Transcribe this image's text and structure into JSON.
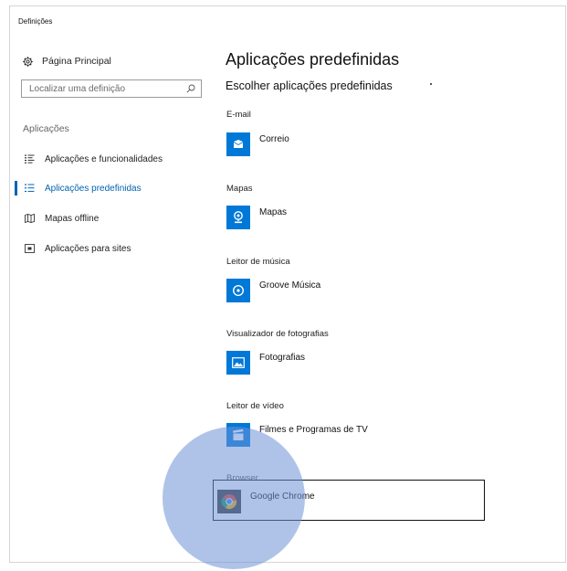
{
  "window": {
    "title": "Definições"
  },
  "sidebar": {
    "home_label": "Página Principal",
    "search_placeholder": "Localizar uma definição",
    "section_label": "Aplicações",
    "items": [
      {
        "label": "Aplicações e funcionalidades",
        "icon": "list-icon"
      },
      {
        "label": "Aplicações predefinidas",
        "icon": "default-apps-icon",
        "active": true
      },
      {
        "label": "Mapas offline",
        "icon": "map-icon"
      },
      {
        "label": "Aplicações para sites",
        "icon": "web-app-icon"
      }
    ]
  },
  "main": {
    "title": "Aplicações predefinidas",
    "subtitle": "Escolher aplicações predefinidas",
    "categories": [
      {
        "label": "E-mail",
        "app": "Correio",
        "icon": "mail-icon"
      },
      {
        "label": "Mapas",
        "app": "Mapas",
        "icon": "maps-pin-icon"
      },
      {
        "label": "Leitor de música",
        "app": "Groove Música",
        "icon": "music-disc-icon"
      },
      {
        "label": "Visualizador de fotografias",
        "app": "Fotografias",
        "icon": "photo-icon"
      },
      {
        "label": "Leitor de vídeo",
        "app": "Filmes e Programas de TV",
        "icon": "film-icon"
      },
      {
        "label": "Browser",
        "app": "Google Chrome",
        "icon": "chrome-icon"
      }
    ]
  },
  "colors": {
    "accent": "#0078d7",
    "active_nav": "#0063b1",
    "touch_indicator": "#6e91d7"
  }
}
